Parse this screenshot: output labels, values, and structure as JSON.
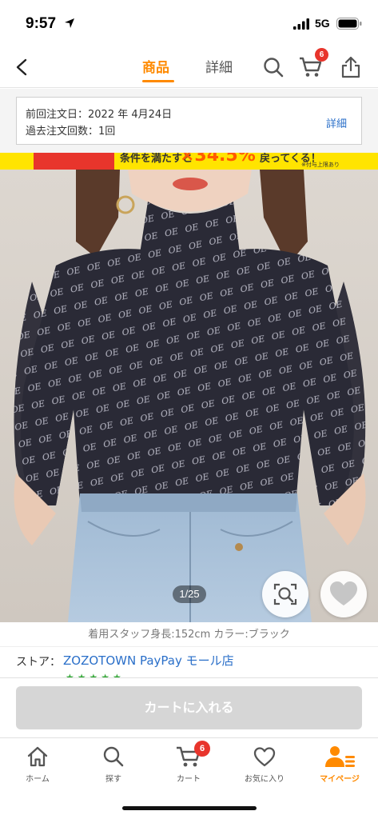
{
  "status_bar": {
    "time": "9:57",
    "network": "5G",
    "battery_icon": "battery-icon"
  },
  "nav": {
    "tabs": [
      {
        "label": "商品",
        "active": true
      },
      {
        "label": "詳細",
        "active": false
      }
    ],
    "cart_count": "6",
    "accent_color": "#ff8a00"
  },
  "order_info": {
    "last_order_label": "前回注文日：2022 年 4月24日",
    "past_orders_label": "過去注文回数：1回",
    "detail_link": "詳細"
  },
  "banner": {
    "text": "条件を満たすと",
    "highlight": "×34.5%",
    "tail": "戻ってくる！",
    "note": "※付与上限あり"
  },
  "product": {
    "image_counter": "1/25",
    "staff_caption": "着用スタッフ身長:152cm カラー:ブラック",
    "store_label": "ストア：",
    "store_name": "ZOZOTOWN PayPay モール店",
    "rating_stars": "★★★★★"
  },
  "actions": {
    "add_to_cart": "カートに入れる"
  },
  "tab_bar": {
    "items": [
      {
        "label": "ホーム",
        "icon": "home-icon"
      },
      {
        "label": "探す",
        "icon": "search-icon"
      },
      {
        "label": "カート",
        "icon": "cart-icon",
        "badge": "6"
      },
      {
        "label": "お気に入り",
        "icon": "heart-icon"
      },
      {
        "label": "マイページ",
        "icon": "person-icon",
        "active": true
      }
    ]
  }
}
